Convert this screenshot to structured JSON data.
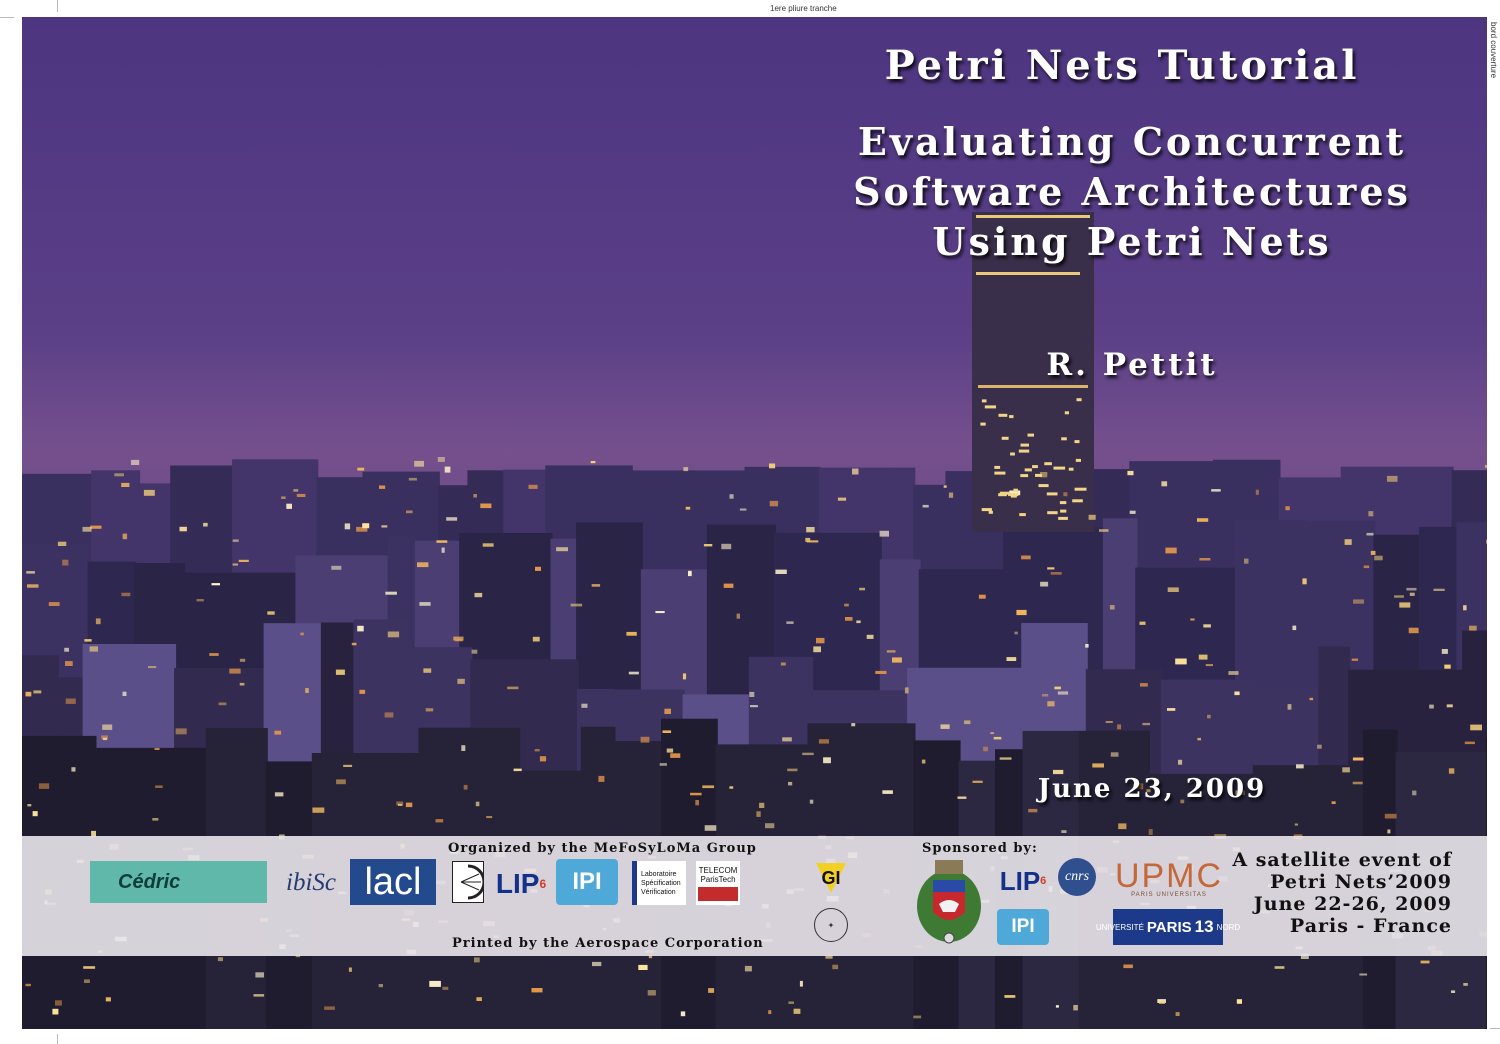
{
  "print_marks": {
    "top_fold": "1ere pliure tranche",
    "side_edge": "bord couverture"
  },
  "cover": {
    "tutorial_title": "Petri Nets Tutorial",
    "subtitle_lines": [
      "Evaluating Concurrent",
      "Software Architectures",
      "Using Petri Nets"
    ],
    "author": "R. Pettit",
    "date": "June 23, 2009"
  },
  "band": {
    "organized_by": "Organized by the MeFoSyLoMa Group",
    "printed_by": "Printed by the Aerospace Corporation",
    "sponsored_by": "Sponsored by:",
    "satellite_lines": [
      "A satellite event of",
      "Petri Nets’2009",
      "June 22-26, 2009",
      "Paris - France"
    ]
  },
  "logos": {
    "cedric": "Cédric",
    "ibisc": "ibiSc",
    "lacl": "lacl",
    "lip6_main": "LIP",
    "lip6_num": "6",
    "ipi": "IPI",
    "lsv_lines": [
      "Laboratoire",
      "Spécification",
      "Vérification"
    ],
    "telecom_lines": [
      "TELECOM",
      "ParisTech"
    ],
    "gi": "GI",
    "cnrs": "cnrs",
    "upmc": "UPMC",
    "upmc_sub": "PARIS UNIVERSITAS",
    "paris13_prefix": "UNIVERSITÉ",
    "paris13_name": "PARIS",
    "paris13_num": "13",
    "paris13_sub": "NORD"
  },
  "colors": {
    "sky_top": "#4d3580",
    "sky_mid": "#6b4a8a",
    "city_dark": "#1c1a2a",
    "band_bg": "#e6e2e8",
    "cedric_teal": "#5fb8a9",
    "lacl_blue": "#244a8e",
    "lip6_blue": "#14318a",
    "ipi_blue": "#4fa9d8",
    "upmc_orange": "#c4683a"
  }
}
